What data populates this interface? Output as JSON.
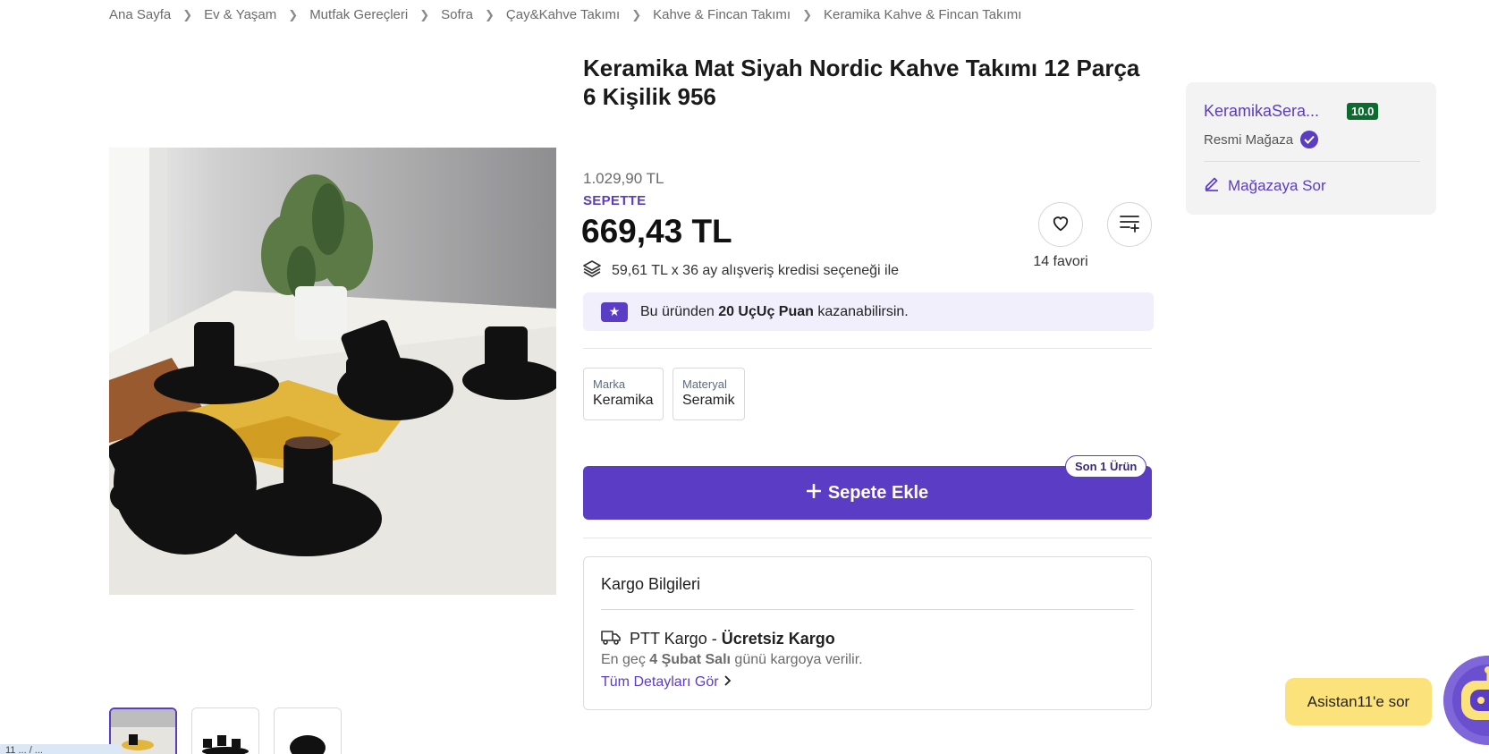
{
  "breadcrumb": {
    "items": [
      {
        "label": "Ana Sayfa"
      },
      {
        "label": "Ev & Yaşam"
      },
      {
        "label": "Mutfak Gereçleri"
      },
      {
        "label": "Sofra"
      },
      {
        "label": "Çay&Kahve Takımı"
      },
      {
        "label": "Kahve & Fincan Takımı"
      },
      {
        "label": "Keramika Kahve & Fincan Takımı"
      }
    ],
    "separator_icon": "chevron-right-icon"
  },
  "product": {
    "title": "Keramika Mat Siyah Nordic Kahve Takımı 12 Parça 6 Kişilik 956",
    "old_price": "1.029,90 TL",
    "basket_label": "SEPETTE",
    "price": "669,43 TL",
    "credit_text": "59,61 TL x 36 ay alışveriş kredisi seçeneği ile",
    "favorites": "14 favori",
    "points": {
      "prefix": "Bu üründen ",
      "highlight": "20 UçUç Puan",
      "suffix": " kazanabilirsin."
    },
    "attributes": [
      {
        "key": "Marka",
        "value": "Keramika"
      },
      {
        "key": "Materyal",
        "value": "Seramik"
      }
    ],
    "add_to_cart": "Sepete Ekle",
    "stock_badge": "Son 1 Ürün"
  },
  "cargo": {
    "title": "Kargo Bilgileri",
    "carrier": "PTT Kargo",
    "dash": " - ",
    "free": "Ücretsiz Kargo",
    "eta_prefix": "En geç ",
    "eta_date": "4 Şubat Salı",
    "eta_suffix": " günü kargoya verilir.",
    "details_link": "Tüm Detayları Gör"
  },
  "seller": {
    "name": "KeramikaSera...",
    "score": "10.0",
    "official": "Resmi Mağaza",
    "ask": "Mağazaya Sor"
  },
  "assistant": {
    "label": "Asistan11'e sor"
  },
  "corner_tag": "11 ... / ...",
  "colors": {
    "accent": "#5b3cc4",
    "score_green": "#0e6b2f",
    "assistant_yellow": "#fce27a",
    "points_bg": "#f1effb"
  }
}
